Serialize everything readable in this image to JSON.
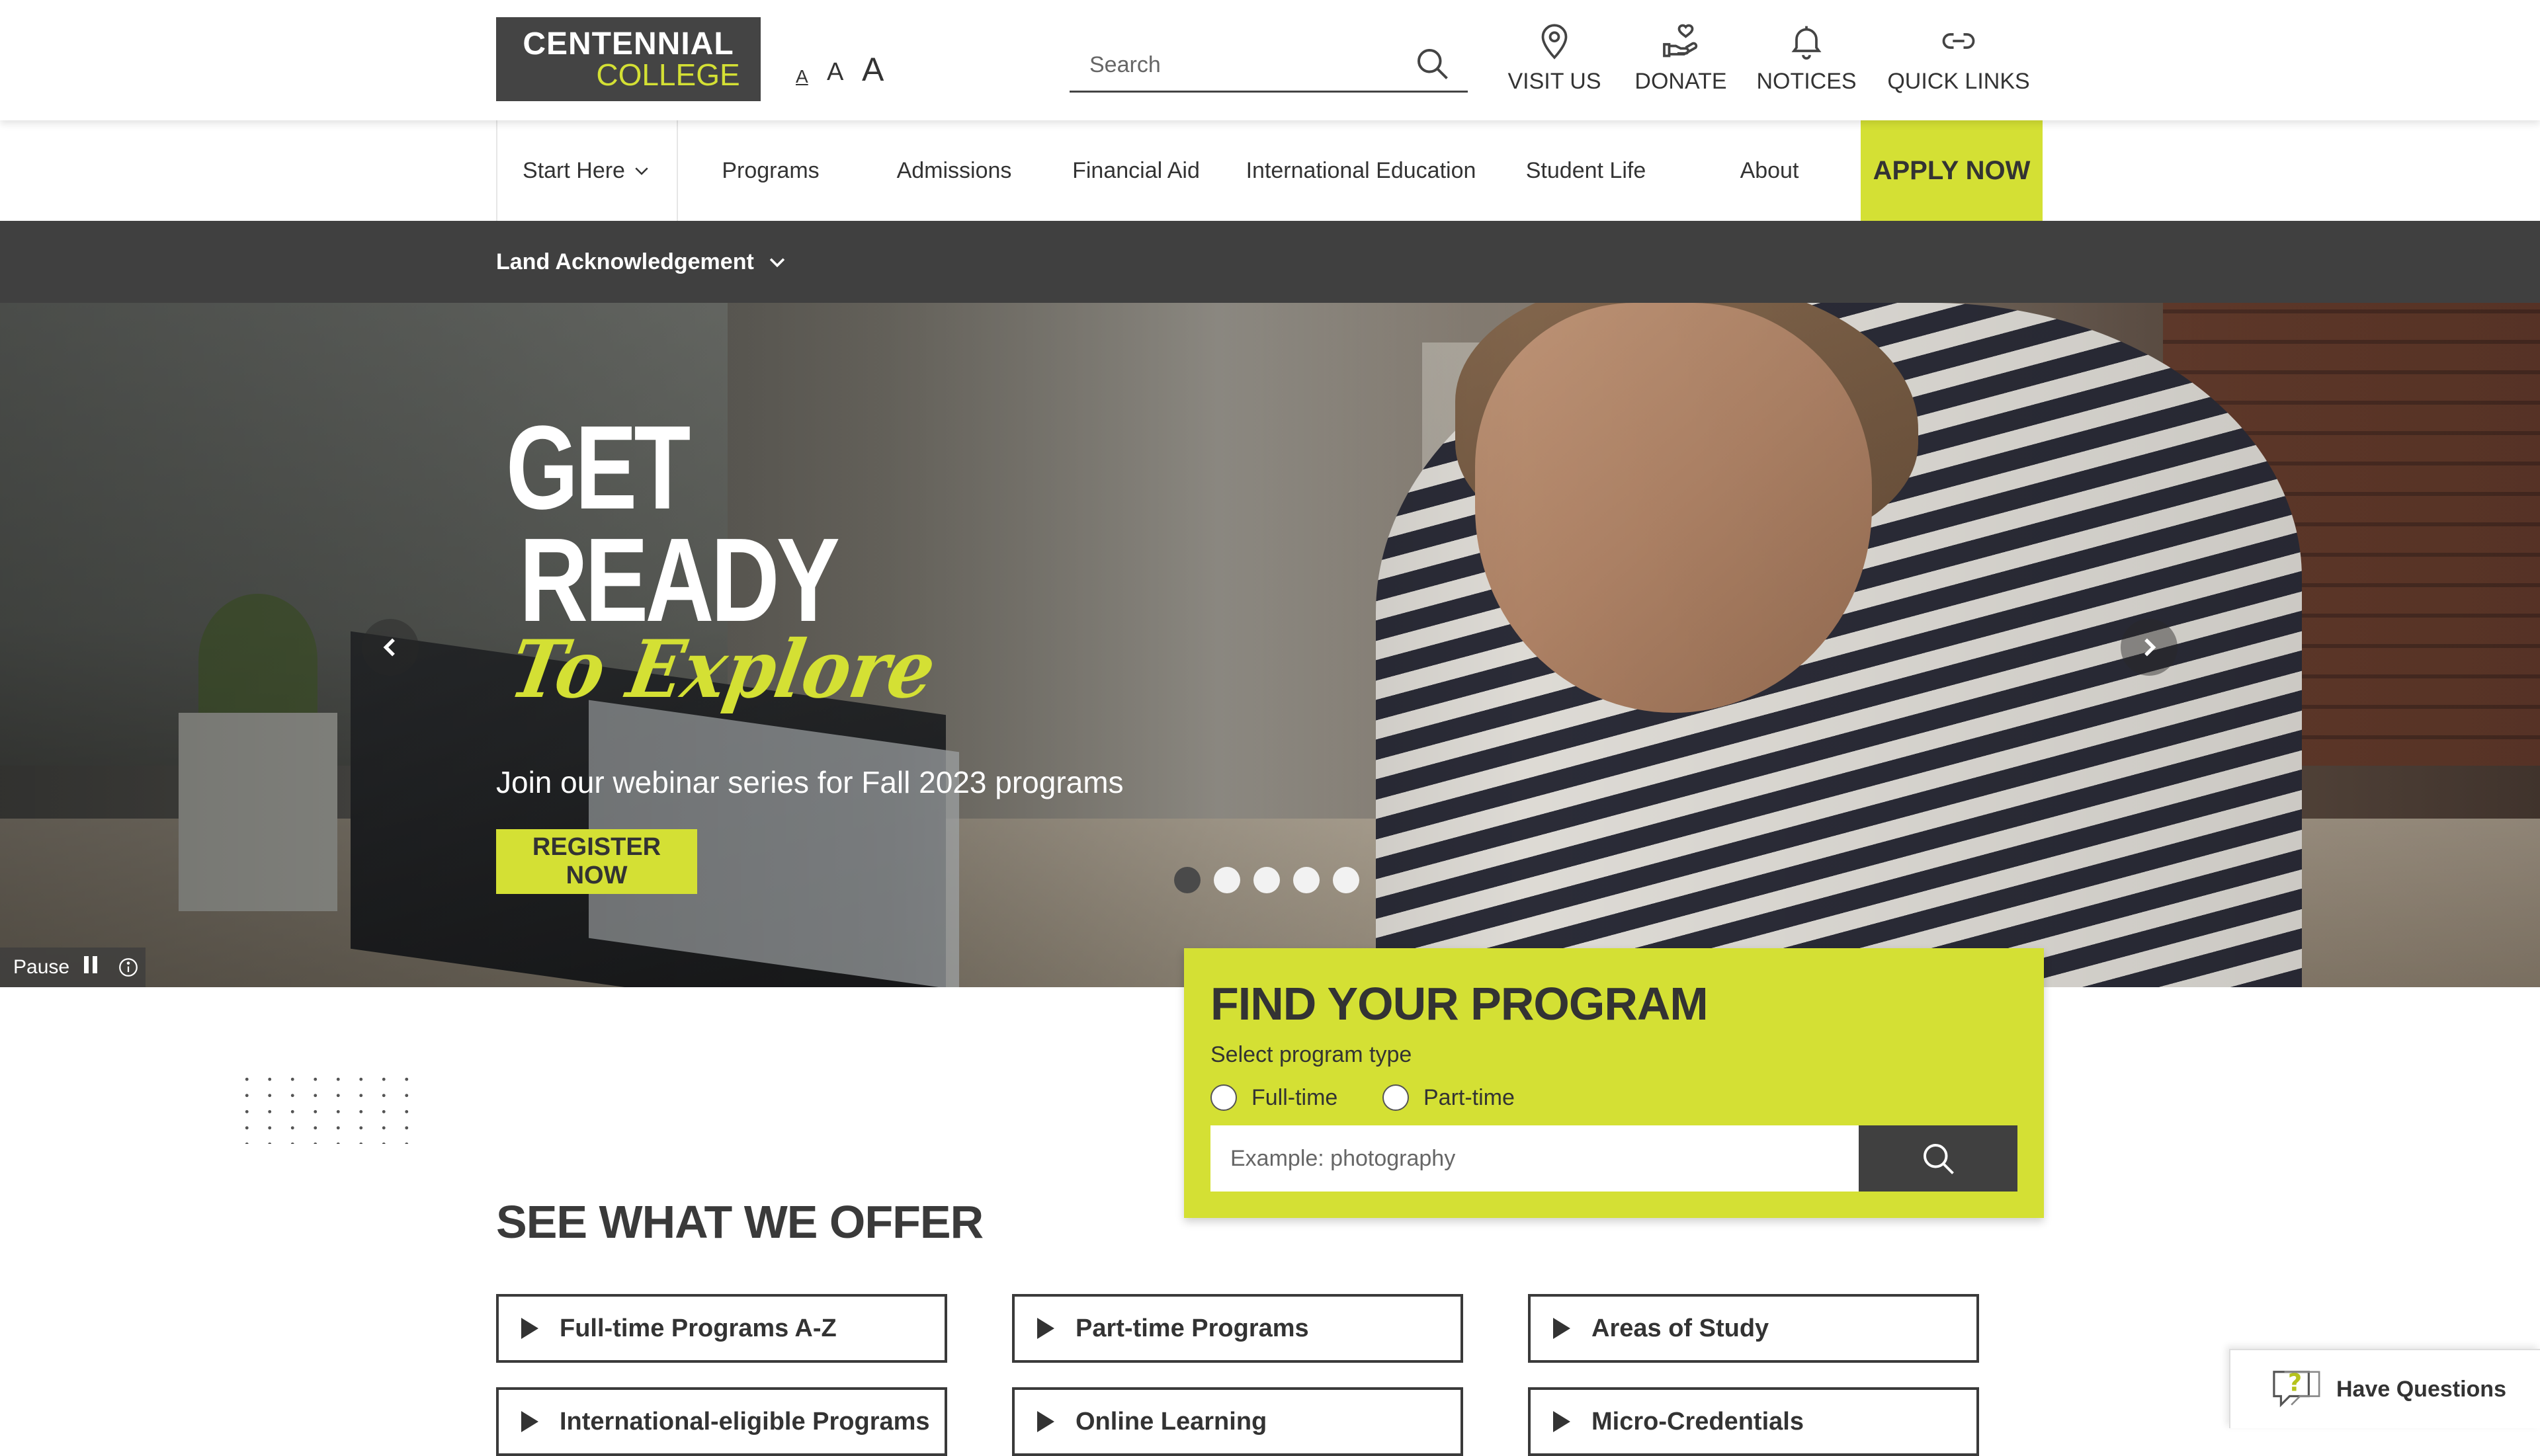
{
  "header": {
    "logo": {
      "line1": "CENTENNIAL",
      "line2": "COLLEGE"
    },
    "font_size_controls": [
      "A",
      "A",
      "A"
    ],
    "search": {
      "placeholder": "Search"
    },
    "utility_links": [
      {
        "label": "VISIT US",
        "icon": "map-pin-icon"
      },
      {
        "label": "DONATE",
        "icon": "hand-heart-icon"
      },
      {
        "label": "NOTICES",
        "icon": "bell-icon"
      },
      {
        "label": "QUICK LINKS",
        "icon": "link-icon"
      }
    ]
  },
  "nav": {
    "items": [
      "Start Here",
      "Programs",
      "Admissions",
      "Financial Aid",
      "International Education",
      "Student Life",
      "About"
    ],
    "apply": "APPLY NOW"
  },
  "land_acknowledgement": "Land Acknowledgement",
  "hero": {
    "title_get": "GET",
    "title_ready": "READY",
    "title_explore": "To Explore",
    "subtitle": "Join our webinar series for Fall 2023 programs",
    "cta": "REGISTER NOW",
    "slides_total": 5,
    "active_slide": 1,
    "pause_label": "Pause"
  },
  "finder": {
    "title": "FIND YOUR PROGRAM",
    "select_label": "Select program type",
    "options": [
      "Full-time",
      "Part-time"
    ],
    "input_placeholder": "Example: photography"
  },
  "offer": {
    "title": "SEE WHAT WE OFFER",
    "items": [
      "Full-time Programs A-Z",
      "Part-time Programs",
      "Areas of Study",
      "International-eligible Programs",
      "Online Learning",
      "Micro-Credentials"
    ]
  },
  "chat": {
    "label": "Have Questions"
  },
  "colors": {
    "accent": "#d4e034",
    "dark": "#404040",
    "text": "#333333"
  }
}
